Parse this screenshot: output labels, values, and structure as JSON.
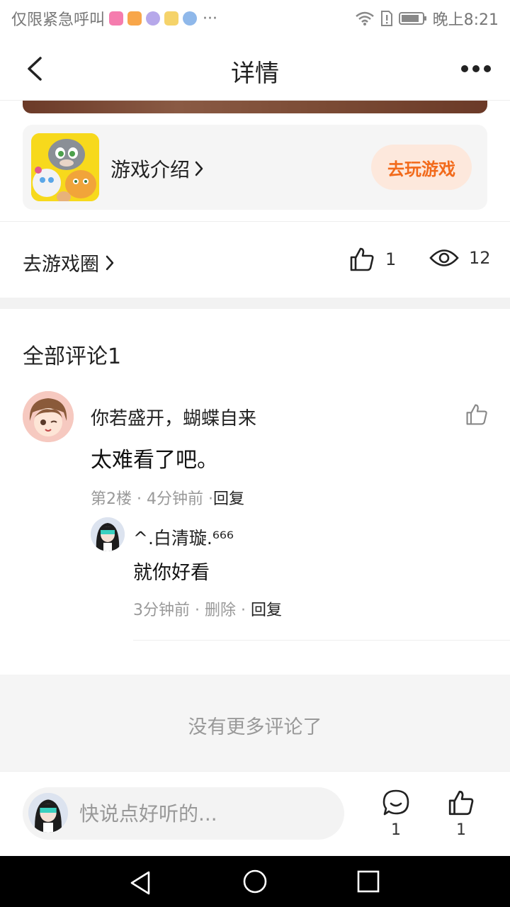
{
  "status_bar": {
    "left_text": "仅限紧急呼叫",
    "overflow": "···",
    "time": "晚上8:21"
  },
  "header": {
    "title": "详情"
  },
  "game_card": {
    "intro_label": "游戏介绍",
    "play_button": "去玩游戏"
  },
  "circle_row": {
    "go_circle_label": "去游戏圈",
    "like_count": "1",
    "view_count": "12"
  },
  "comments": {
    "title": "全部评论1",
    "items": [
      {
        "user": "你若盛开，蝴蝶自来",
        "text": "太难看了吧。",
        "floor": "第2楼",
        "time": "4分钟前",
        "reply_label": "回复",
        "replies": [
          {
            "user": "^.白清璇.⁶⁶⁶",
            "text": "就你好看",
            "time": "3分钟前",
            "delete_label": "删除",
            "reply_label": "回复"
          }
        ]
      }
    ],
    "no_more": "没有更多评论了"
  },
  "bottom_bar": {
    "input_placeholder": "快说点好听的...",
    "comment_count": "1",
    "like_count": "1"
  },
  "colors": {
    "accent_orange": "#f26a1b",
    "play_button_bg": "#fde8dc",
    "card_bg": "#f5f5f5"
  }
}
